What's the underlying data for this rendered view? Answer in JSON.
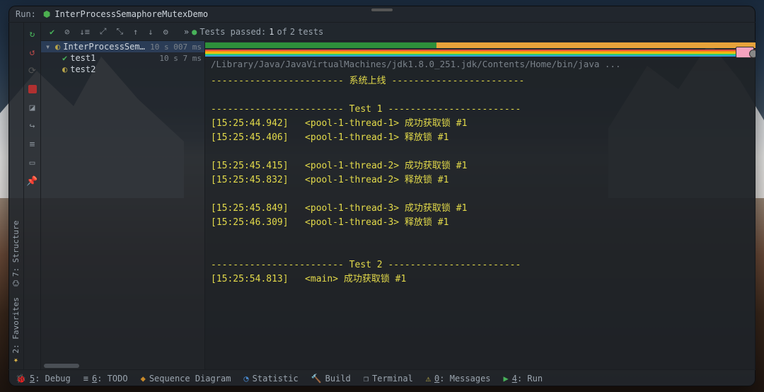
{
  "run_bar": {
    "label": "Run:",
    "config_name": "InterProcessSemaphoreMutexDemo"
  },
  "toolbar": {
    "status_prefix": "Tests passed:",
    "passed": "1",
    "of_word": "of",
    "total": "2",
    "suffix": "tests"
  },
  "test_tree": {
    "root": {
      "name": "InterProcessSemap",
      "duration": "10 s 007 ms"
    },
    "children": [
      {
        "name": "test1",
        "status": "passed",
        "duration": "10 s 7 ms"
      },
      {
        "name": "test2",
        "status": "running",
        "duration": ""
      }
    ]
  },
  "console": {
    "cmd": "/Library/Java/JavaVirtualMachines/jdk1.8.0_251.jdk/Contents/Home/bin/java ...",
    "lines": [
      "------------------------ 系统上线 ------------------------",
      "",
      "------------------------ Test 1 ------------------------",
      "[15:25:44.942]   <pool-1-thread-1> 成功获取锁 #1",
      "[15:25:45.406]   <pool-1-thread-1> 释放锁 #1",
      "",
      "[15:25:45.415]   <pool-1-thread-2> 成功获取锁 #1",
      "[15:25:45.832]   <pool-1-thread-2> 释放锁 #1",
      "",
      "[15:25:45.849]   <pool-1-thread-3> 成功获取锁 #1",
      "[15:25:46.309]   <pool-1-thread-3> 释放锁 #1",
      "",
      "",
      "------------------------ Test 2 ------------------------",
      "[15:25:54.813]   <main> 成功获取锁 #1"
    ]
  },
  "vtabs": {
    "structure": "7: Structure",
    "favorites": "2: Favorites"
  },
  "status": {
    "debug": "5: Debug",
    "todo": "6: TODO",
    "sequence": "Sequence Diagram",
    "statistic": "Statistic",
    "build": "Build",
    "terminal": "Terminal",
    "event": "0: Messages",
    "run": "4: Run"
  }
}
